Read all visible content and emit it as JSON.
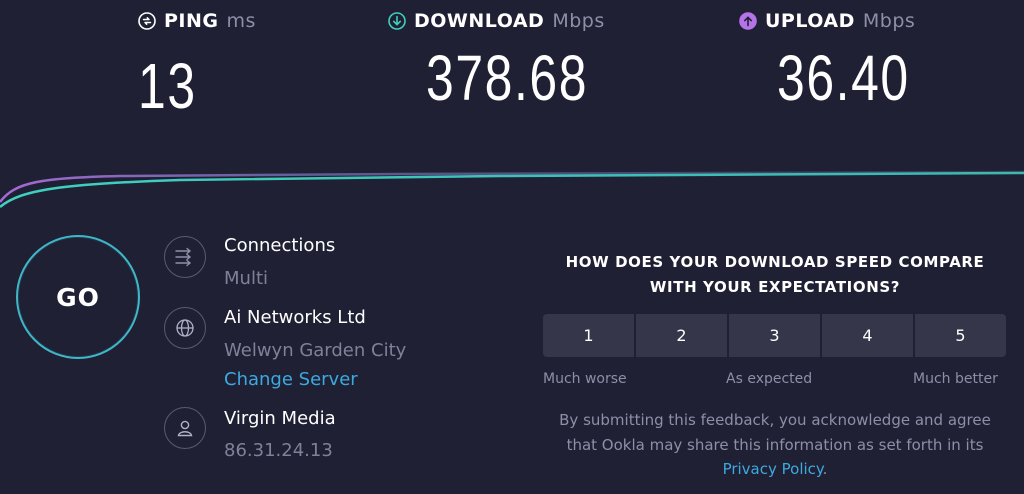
{
  "metrics": {
    "ping": {
      "label": "PING",
      "unit": "ms",
      "value": "13",
      "icon": "ping-icon",
      "color": "#ffffff"
    },
    "download": {
      "label": "DOWNLOAD",
      "unit": "Mbps",
      "value": "378.68",
      "icon": "download-arrow-icon",
      "color": "#3fd0c0"
    },
    "upload": {
      "label": "UPLOAD",
      "unit": "Mbps",
      "value": "36.40",
      "icon": "upload-arrow-icon",
      "color": "#b573e8"
    }
  },
  "go_button": {
    "label": "GO"
  },
  "info": {
    "connections": {
      "icon": "connections-icon",
      "title": "Connections",
      "value": "Multi"
    },
    "server": {
      "icon": "globe-icon",
      "title": "Ai Networks Ltd",
      "location": "Welwyn Garden City",
      "change_link": "Change Server"
    },
    "isp": {
      "icon": "user-icon",
      "title": "Virgin Media",
      "ip": "86.31.24.13"
    }
  },
  "survey": {
    "question": "HOW DOES YOUR DOWNLOAD SPEED COMPARE WITH YOUR EXPECTATIONS?",
    "options": [
      "1",
      "2",
      "3",
      "4",
      "5"
    ],
    "scale_low": "Much worse",
    "scale_mid": "As expected",
    "scale_high": "Much better",
    "disclaimer_pre": "By submitting this feedback, you acknowledge and agree that Ookla may share this information as set forth in its",
    "privacy_link": "Privacy Policy",
    "disclaimer_post": "."
  },
  "colors": {
    "background": "#1f2033",
    "download_line": "#3fd0c0",
    "upload_line": "#b573e8",
    "link": "#3da9e0",
    "muted_text": "#7f8199"
  }
}
